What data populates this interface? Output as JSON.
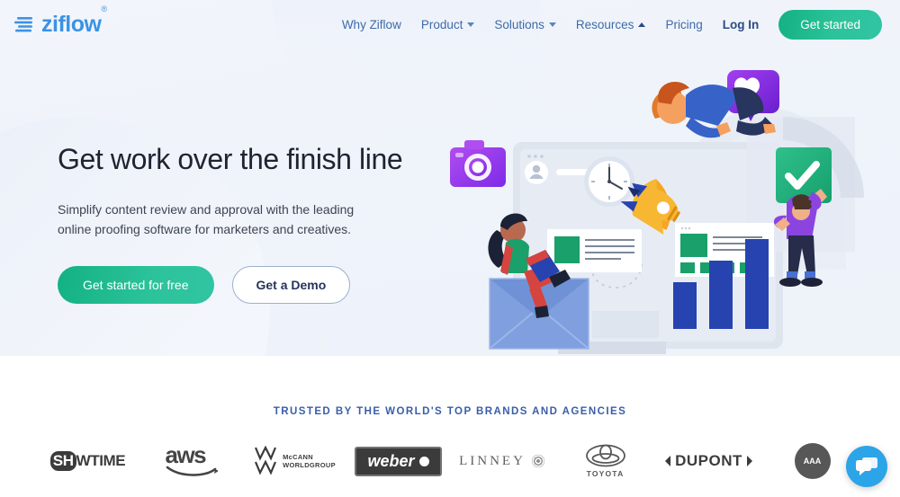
{
  "nav": {
    "logo_text": "ziflow",
    "logo_tm": "®",
    "logo_icon": "stacked-lines-icon",
    "links": [
      {
        "label": "Why Ziflow",
        "caret": "none"
      },
      {
        "label": "Product",
        "caret": "down"
      },
      {
        "label": "Solutions",
        "caret": "down"
      },
      {
        "label": "Resources",
        "caret": "up"
      },
      {
        "label": "Pricing",
        "caret": "none"
      },
      {
        "label": "Log In",
        "caret": "none"
      }
    ],
    "cta_label": "Get started"
  },
  "hero": {
    "title": "Get work over the finish line",
    "subtitle": "Simplify content review and approval with the leading online proofing software for marketers and creatives.",
    "primary_cta": "Get started for free",
    "secondary_cta": "Get a Demo"
  },
  "trust": {
    "title": "TRUSTED BY THE WORLD'S TOP BRANDS AND AGENCIES",
    "logos": [
      {
        "name": "Showtime",
        "part1": "SH",
        "part2": "WTIME"
      },
      {
        "name": "aws",
        "word": "aws"
      },
      {
        "name": "McCann Worldgroup",
        "mark": "M\nW",
        "line1": "McCANN",
        "line2": "WORLDGROUP"
      },
      {
        "name": "Weber",
        "word": "weber"
      },
      {
        "name": "Linney",
        "word": "LINNEY"
      },
      {
        "name": "Toyota",
        "word": "TOYOTA"
      },
      {
        "name": "DuPont",
        "word": "DUPONT"
      },
      {
        "name": "AAA",
        "word": "AAA"
      }
    ]
  },
  "chat": {
    "icon": "chat-bubbles-icon",
    "label": "Open chat"
  },
  "colors": {
    "brand_blue": "#3b93e3",
    "cta_green": "#2cc39a",
    "nav_link": "#3e6ba8",
    "heading": "#1e2430",
    "trust_title": "#3a5ea8",
    "hero_bg": "#eff3fa",
    "chat_blue": "#2ca4e8"
  }
}
